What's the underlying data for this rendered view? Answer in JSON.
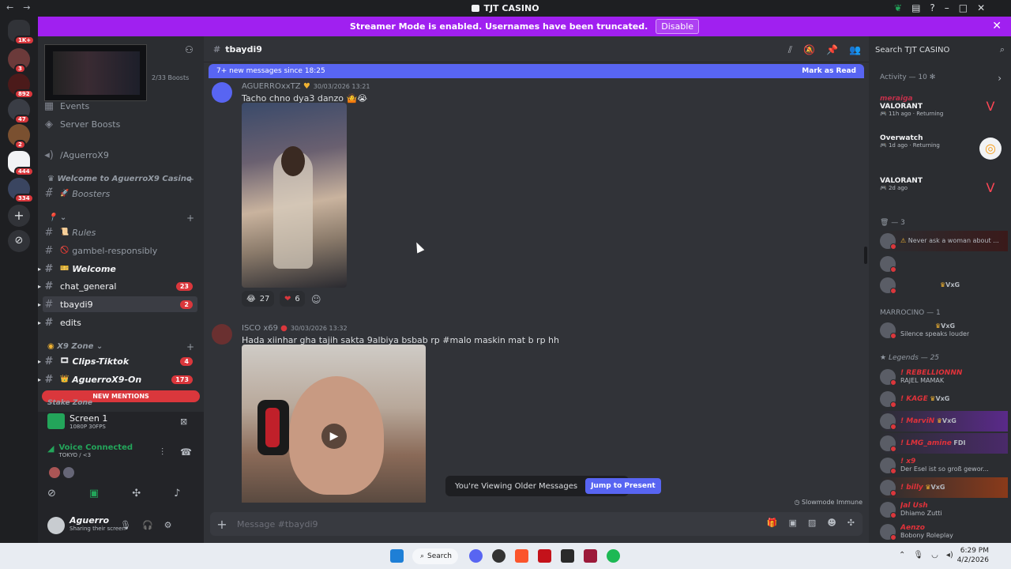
{
  "window": {
    "title": "TJT CASINO"
  },
  "banner": {
    "text": "Streamer Mode is enabled. Usernames have been truncated.",
    "button": "Disable"
  },
  "servers": {
    "badges": [
      "1K+",
      "3",
      "892",
      "47",
      "2",
      "444",
      "334"
    ]
  },
  "sidebar": {
    "boosts": "2/33 Boosts",
    "items": [
      {
        "label": "Events"
      },
      {
        "label": "Server Boosts"
      },
      {
        "label": "/AguerroX9"
      }
    ],
    "category1": "Welcome to AguerroX9 Casino",
    "boosters": "Boosters",
    "category2": "",
    "rules": "Rules",
    "gambel": "gambel-responsibly",
    "welcome": "Welcome",
    "chat_general": "chat_general",
    "chat_general_count": "23",
    "tbaydi9": "tbaydi9",
    "tbaydi9_count": "2",
    "edits": "edits",
    "category3": "X9 Zone",
    "clips": "Clips-Tiktok",
    "clips_count": "4",
    "aguerro_on": "AguerroX9-On",
    "aguerro_on_count": "173",
    "new_mentions": "NEW MENTIONS",
    "stake_zone": "Stake Zone"
  },
  "stream": {
    "title": "Screen 1",
    "quality": "1080P 30FPS",
    "voice": "Voice Connected",
    "voice_sub": "TOKYO / <3"
  },
  "user": {
    "name": "Aguerro",
    "status": "Sharing their screen"
  },
  "channel": {
    "name": "tbaydi9",
    "new_messages": "7+ new messages since 18:25",
    "mark_read": "Mark as Read"
  },
  "messages": [
    {
      "author": "AGUERROxxTZ",
      "timestamp": "30/03/2026 13:21",
      "text": "Tacho chno dya3 danzo",
      "reactions": [
        {
          "emoji": "😂",
          "count": "27"
        },
        {
          "emoji": "❤",
          "count": "6"
        }
      ]
    },
    {
      "author": "ISCO x69",
      "timestamp": "30/03/2026 13:32",
      "text": "Hada xiinhar gha tajih sakta 9albiya bsbab rp #malo maskin mat b rp hh"
    }
  ],
  "older": {
    "text": "You're Viewing Older Messages",
    "jump": "Jump to Present"
  },
  "slowmode": "Slowmode Immune",
  "composer": {
    "placeholder": "Message #tbaydi9"
  },
  "right": {
    "search": "Search TJT CASINO",
    "activity_header": "Activity — 10",
    "activities": [
      {
        "who": "meraiga",
        "game": "VALORANT",
        "meta": "11h ago",
        "extra": "Returning"
      },
      {
        "who": "",
        "game": "Overwatch",
        "meta": "1d ago",
        "extra": "Returning"
      },
      {
        "who": "",
        "game": "VALORANT",
        "meta": "2d ago",
        "extra": ""
      }
    ],
    "group1": "— 3",
    "m1_status": "Never ask a woman about ...",
    "m3_tag": "VxG",
    "group2": "MARROCINO — 1",
    "m4_tag": "VxG",
    "m4_status": "Silence speaks louder",
    "group3": "Legends — 25",
    "legends": [
      {
        "name": "! REBELLIONNN",
        "status": "RAJEL MAMAK"
      },
      {
        "name": "! KAGE",
        "status": "VxG"
      },
      {
        "name": "! MarviN",
        "status": "VxG"
      },
      {
        "name": "! LMG_amine",
        "status": "FDI"
      },
      {
        "name": "! x9",
        "status": "Der Esel ist so groß gewor..."
      },
      {
        "name": "! billy",
        "status": "VxG"
      },
      {
        "name": "Jal Ush",
        "status": "Dhiamo Zutti"
      },
      {
        "name": "Aenzo",
        "status": "Bobony Roleplay"
      }
    ]
  },
  "taskbar": {
    "search": "Search",
    "time": "6:29 PM",
    "date": "4/2/2026"
  }
}
